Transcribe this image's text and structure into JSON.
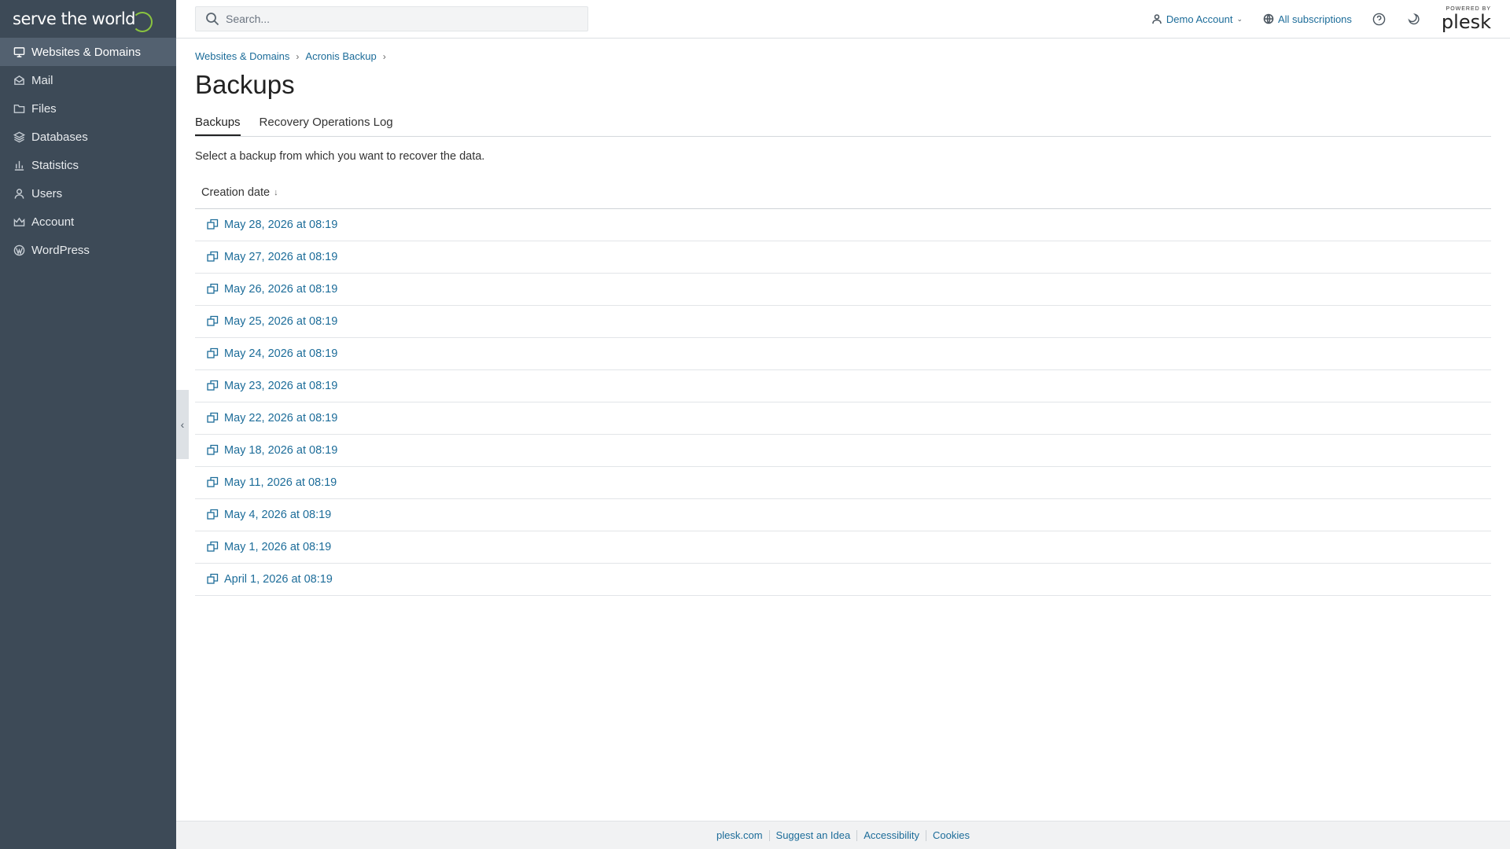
{
  "brand": {
    "logo_text": "serve the world",
    "powered_by": "POWERED BY",
    "plesk": "plesk",
    "accent_color": "#8ac43f"
  },
  "sidebar": {
    "items": [
      {
        "label": "Websites & Domains",
        "icon": "monitor-icon",
        "active": true
      },
      {
        "label": "Mail",
        "icon": "mail-icon"
      },
      {
        "label": "Files",
        "icon": "folder-icon"
      },
      {
        "label": "Databases",
        "icon": "database-icon"
      },
      {
        "label": "Statistics",
        "icon": "bar-chart-icon"
      },
      {
        "label": "Users",
        "icon": "user-icon"
      },
      {
        "label": "Account",
        "icon": "account-icon"
      },
      {
        "label": "WordPress",
        "icon": "wordpress-icon"
      }
    ]
  },
  "header": {
    "search_placeholder": "Search...",
    "account_label": "Demo Account",
    "subscriptions_label": "All subscriptions"
  },
  "breadcrumb": [
    "Websites & Domains",
    "Acronis Backup"
  ],
  "page": {
    "title": "Backups",
    "tabs": [
      "Backups",
      "Recovery Operations Log"
    ],
    "hint": "Select a backup from which you want to recover the data.",
    "column_header": "Creation date",
    "sort_indicator": "↓"
  },
  "backups": [
    "May 28, 2026 at 08:19",
    "May 27, 2026 at 08:19",
    "May 26, 2026 at 08:19",
    "May 25, 2026 at 08:19",
    "May 24, 2026 at 08:19",
    "May 23, 2026 at 08:19",
    "May 22, 2026 at 08:19",
    "May 18, 2026 at 08:19",
    "May 11, 2026 at 08:19",
    "May 4, 2026 at 08:19",
    "May 1, 2026 at 08:19",
    "April 1, 2026 at 08:19"
  ],
  "footer": [
    "plesk.com",
    "Suggest an Idea",
    "Accessibility",
    "Cookies"
  ]
}
